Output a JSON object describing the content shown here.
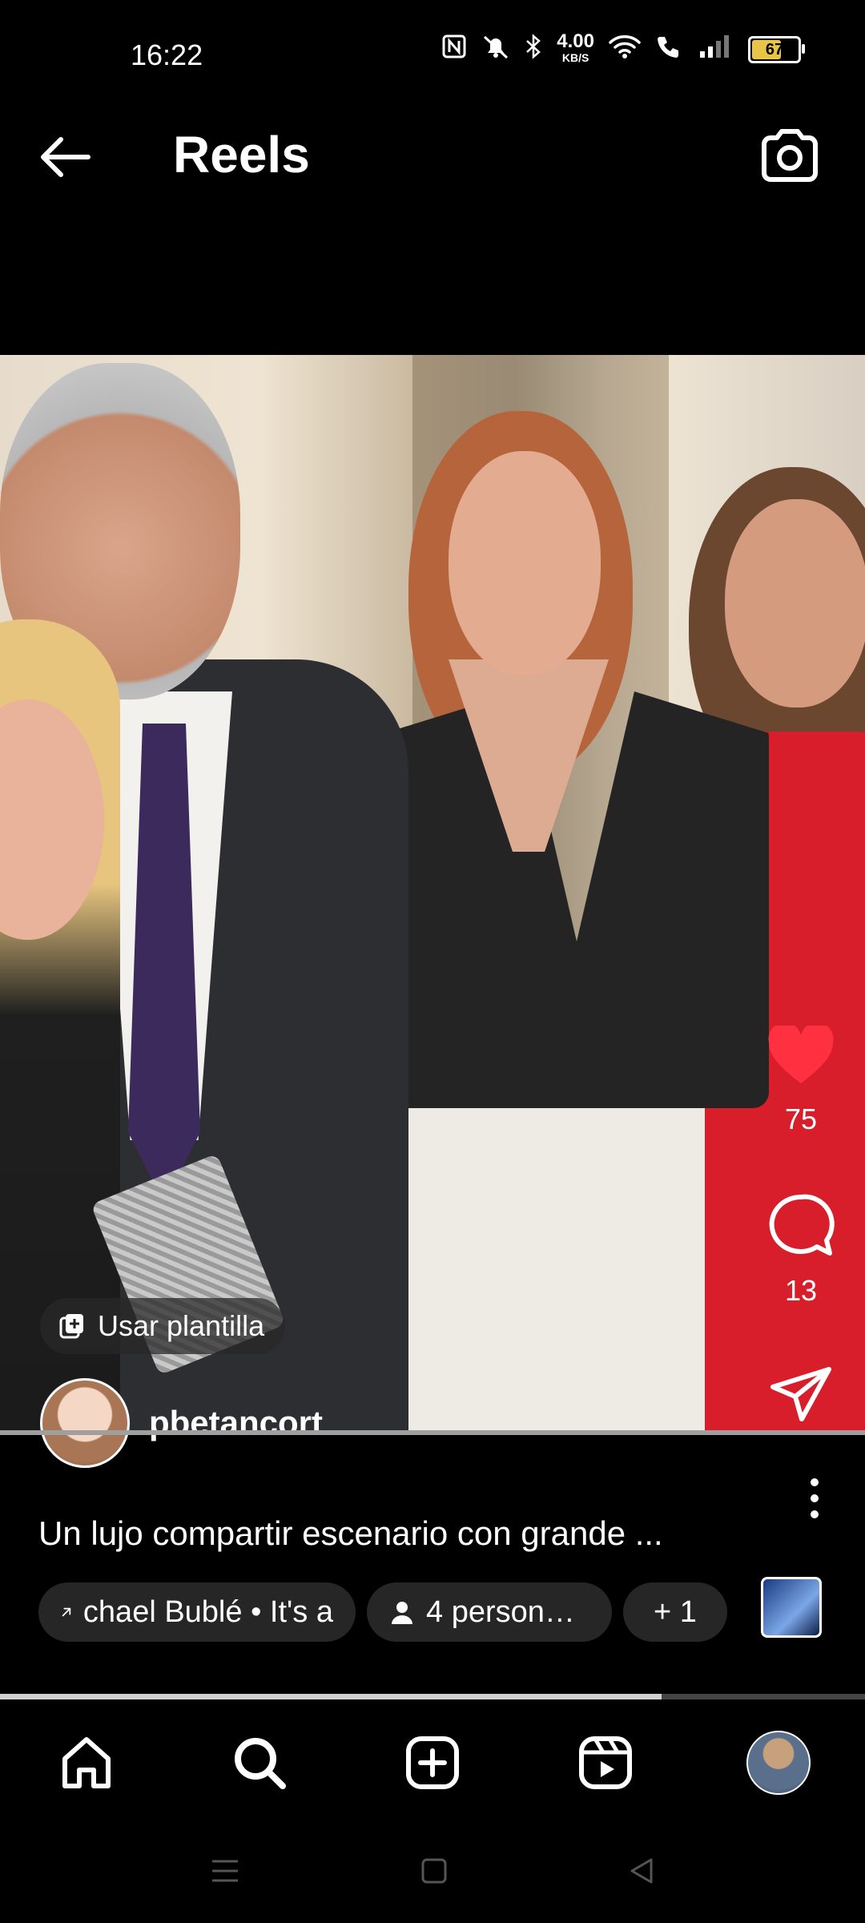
{
  "status_bar": {
    "time": "16:22",
    "net_speed_value": "4.00",
    "net_speed_unit": "KB/S",
    "battery": "67",
    "battery_level": 0.67
  },
  "header": {
    "title": "Reels"
  },
  "reel": {
    "likes": "75",
    "comments": "13",
    "template_label": "Usar plantilla",
    "username": "pbetancort",
    "caption": "Un lujo compartir escenario con grande ...",
    "music_chip": "chael Bublé • It's a",
    "people_chip": "4 person…",
    "more_chip": "+ 1",
    "progress": 0.765
  },
  "colors": {
    "like": "#ff3040",
    "background": "#000000",
    "chip": "#262626"
  }
}
